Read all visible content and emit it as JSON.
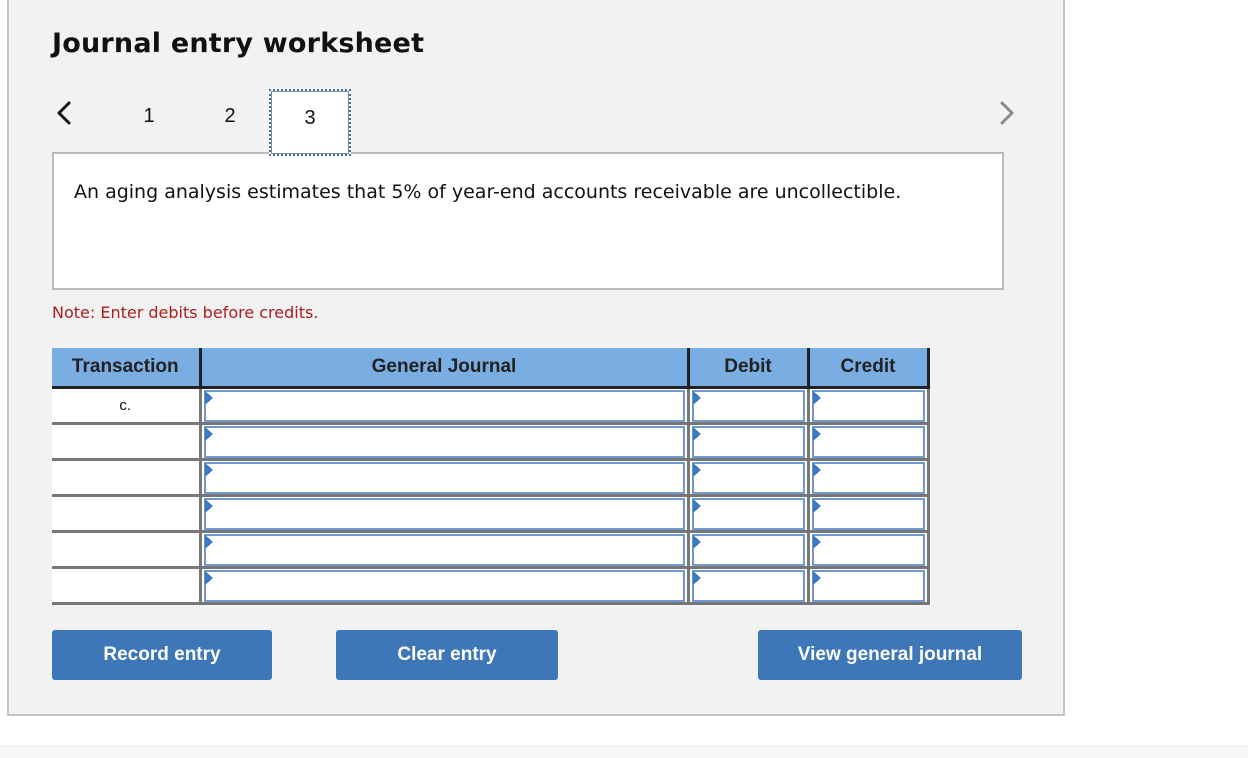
{
  "title": "Journal entry worksheet",
  "nav": {
    "prev_icon": "chevron-left-icon",
    "next_icon": "chevron-right-icon",
    "tabs": [
      {
        "label": "1",
        "active": false
      },
      {
        "label": "2",
        "active": false
      },
      {
        "label": "3",
        "active": true
      }
    ]
  },
  "description": "An aging analysis estimates that 5% of year-end accounts receivable are uncollectible.",
  "note": "Note: Enter debits before credits.",
  "table": {
    "headers": [
      "Transaction",
      "General Journal",
      "Debit",
      "Credit"
    ],
    "rows": [
      {
        "transaction": "c.",
        "account": "",
        "debit": "",
        "credit": ""
      },
      {
        "transaction": "",
        "account": "",
        "debit": "",
        "credit": ""
      },
      {
        "transaction": "",
        "account": "",
        "debit": "",
        "credit": ""
      },
      {
        "transaction": "",
        "account": "",
        "debit": "",
        "credit": ""
      },
      {
        "transaction": "",
        "account": "",
        "debit": "",
        "credit": ""
      },
      {
        "transaction": "",
        "account": "",
        "debit": "",
        "credit": ""
      }
    ]
  },
  "buttons": {
    "record": "Record entry",
    "clear": "Clear entry",
    "view": "View general journal"
  },
  "colors": {
    "header_bg": "#7aade2",
    "button_bg": "#3d77b8",
    "note_text": "#b01c1c",
    "input_border": "#6f9ad2"
  }
}
